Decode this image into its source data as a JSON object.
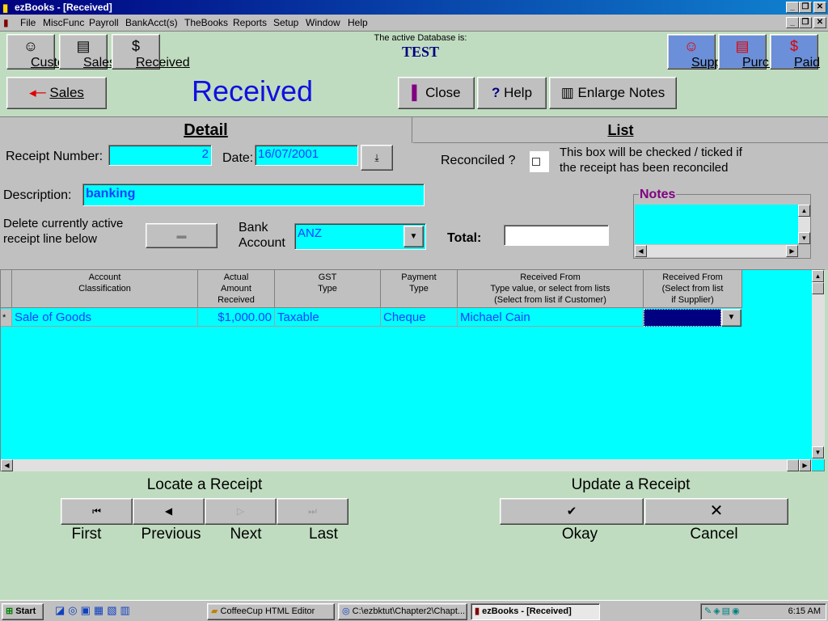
{
  "window": {
    "title": "ezBooks - [Received]",
    "controls": {
      "minimize": "_",
      "restore": "❐",
      "close": "✕"
    }
  },
  "menu": [
    "File",
    "MiscFunc",
    "Payroll",
    "BankAcct(s)",
    "TheBooks",
    "Reports",
    "Setup",
    "Window",
    "Help"
  ],
  "toolbar": {
    "left": [
      {
        "label": "Customers",
        "icon": "smiley-icon"
      },
      {
        "label": "Sales",
        "icon": "documents-icon"
      },
      {
        "label": "Received",
        "icon": "dollar-icon"
      }
    ],
    "right": [
      {
        "label": "Suppliers",
        "icon": "smiley-icon"
      },
      {
        "label": "Purchases",
        "icon": "documents-icon"
      },
      {
        "label": "Paid",
        "icon": "dollar-icon"
      }
    ],
    "active_db_label": "The active Database is:",
    "active_db_name": "TEST"
  },
  "actions": {
    "back_label": "Sales",
    "page_title": "Received",
    "close_label": "Close",
    "help_label": "Help",
    "enlarge_label": "Enlarge Notes"
  },
  "tabs": {
    "detail": "Detail",
    "list": "List"
  },
  "form": {
    "receipt_number_label": "Receipt Number:",
    "receipt_number": "2",
    "date_label": "Date:",
    "date": "16/07/2001",
    "reconciled_label": "Reconciled ?",
    "reconciled_help_1": "This box will be checked / ticked if",
    "reconciled_help_2": "the receipt has been reconciled",
    "description_label": "Description:",
    "description": "banking",
    "delete_label_1": "Delete currently active",
    "delete_label_2": "receipt line below",
    "bank_label_1": "Bank",
    "bank_label_2": "Account",
    "bank_account": "ANZ",
    "total_label": "Total:",
    "total": "",
    "notes_label": "Notes"
  },
  "grid": {
    "headers": [
      [
        "Account",
        "Classification"
      ],
      [
        "Actual",
        "Amount",
        "Received"
      ],
      [
        "GST",
        "Type"
      ],
      [
        "Payment",
        "Type"
      ],
      [
        "Received From",
        "Type value, or select from lists",
        "(Select from list if Customer)"
      ],
      [
        "Received From",
        "(Select from list",
        "if Supplier)"
      ]
    ],
    "rows": [
      {
        "marker": "*",
        "account": "Sale of Goods",
        "amount": "$1,000.00",
        "gst": "Taxable",
        "payment": "Cheque",
        "from_customer": "Michael Cain",
        "from_supplier": ""
      }
    ]
  },
  "navigation": {
    "locate_label": "Locate a Receipt",
    "first": "First",
    "previous": "Previous",
    "next": "Next",
    "last": "Last",
    "update_label": "Update a Receipt",
    "okay": "Okay",
    "cancel": "Cancel"
  },
  "taskbar": {
    "start": "Start",
    "tasks": [
      "CoffeeCup HTML Editor",
      "C:\\ezbktut\\Chapter2\\Chapt...",
      "ezBooks - [Received]"
    ],
    "clock": "6:15 AM"
  }
}
